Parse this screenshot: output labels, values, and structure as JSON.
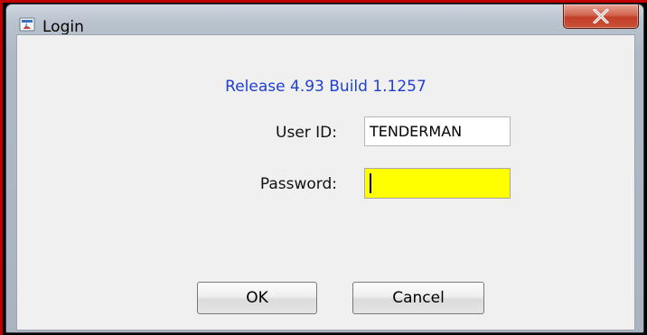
{
  "window": {
    "title": "Login",
    "close_symbol": "X",
    "title_icon": "java-app-icon"
  },
  "form": {
    "release_text": "Release 4.93 Build 1.1257",
    "userid_label": "User ID:",
    "userid_value": "TENDERMAN",
    "password_label": "Password:",
    "password_value": ""
  },
  "buttons": {
    "ok_label": "OK",
    "cancel_label": "Cancel"
  },
  "colors": {
    "release_text": "#1f3fd1",
    "password_bg": "#ffff00",
    "close_button": "#c23e27"
  }
}
